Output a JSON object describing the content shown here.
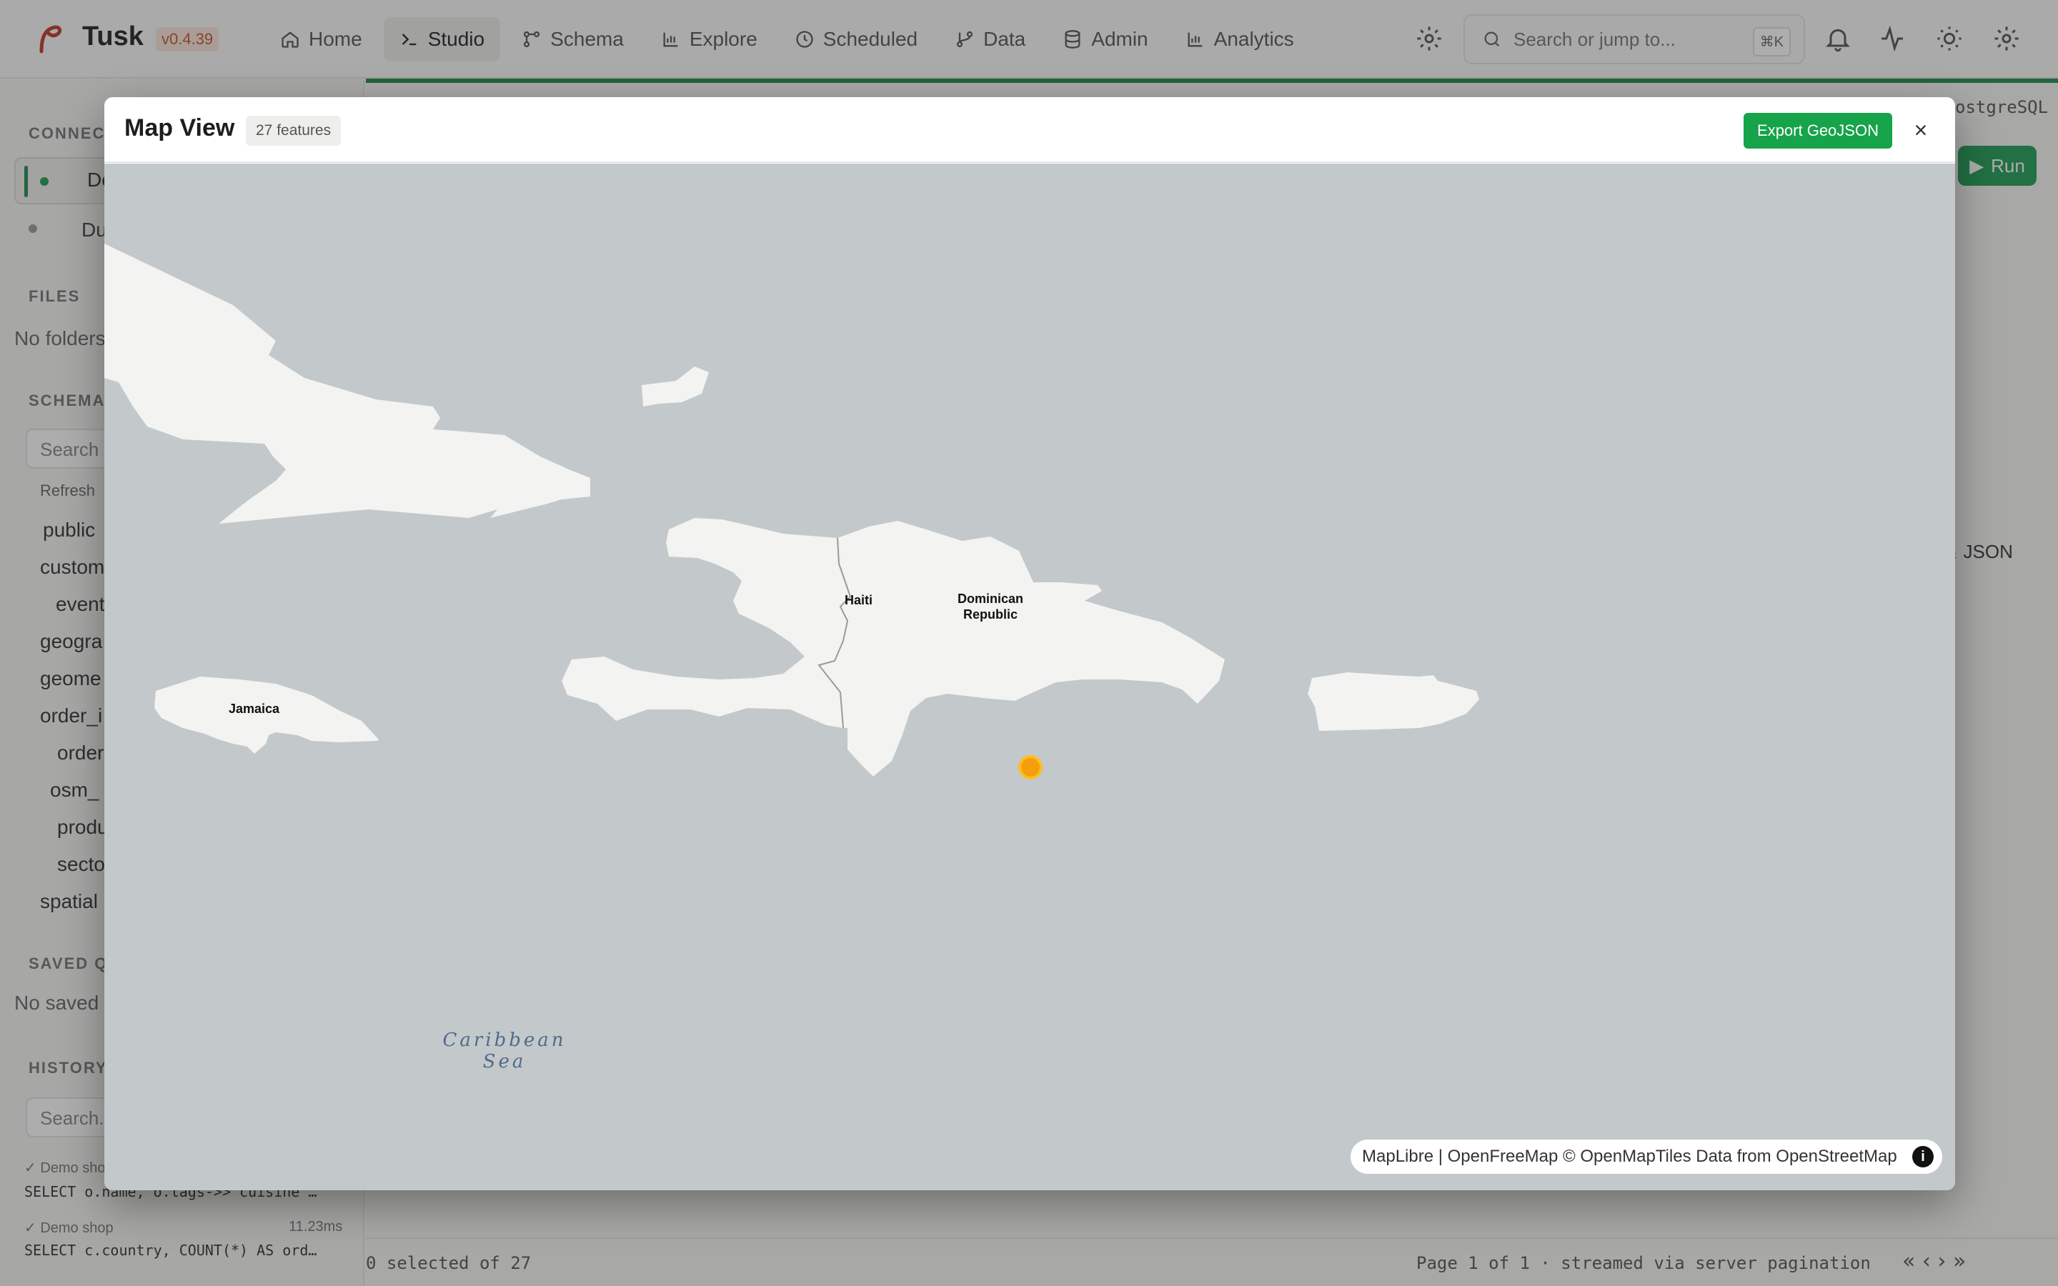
{
  "app": {
    "name": "Tusk",
    "version": "v0.4.39"
  },
  "nav": {
    "items": [
      {
        "label": "Home",
        "icon": "home-icon"
      },
      {
        "label": "Studio",
        "icon": "terminal-icon"
      },
      {
        "label": "Schema",
        "icon": "schema-icon"
      },
      {
        "label": "Explore",
        "icon": "chart-icon"
      },
      {
        "label": "Scheduled",
        "icon": "clock-icon"
      },
      {
        "label": "Data",
        "icon": "branch-icon"
      },
      {
        "label": "Admin",
        "icon": "database-icon"
      },
      {
        "label": "Analytics",
        "icon": "chart-icon"
      }
    ],
    "active": "Studio"
  },
  "search": {
    "placeholder": "Search or jump to...",
    "shortcut": "⌘K"
  },
  "sidebar": {
    "connections_title": "CONNECT",
    "connections": [
      {
        "label": "De"
      },
      {
        "label": "Du"
      }
    ],
    "files_title": "FILES",
    "files_empty": "No folders",
    "schema_title": "SCHEMA",
    "schema_search_placeholder": "Search t",
    "refresh_label": "Refresh",
    "schema_name": "public",
    "tables": [
      "custom",
      "event",
      "geogra",
      "geome",
      "order_i",
      "order",
      "osm_",
      "produ",
      "secto",
      "spatial"
    ],
    "saved_title": "SAVED QU",
    "saved_empty": "No saved",
    "history_title": "HISTORY",
    "history_search_placeholder": "Search...",
    "history": [
      {
        "conn": "✓ Demo sho",
        "time": "",
        "sql": "SELECT o.name, o.tags->>'cuisine'…"
      },
      {
        "conn": "✓ Demo shop",
        "time": "11.23ms",
        "sql": "SELECT c.country, COUNT(*) AS ord…"
      }
    ]
  },
  "main": {
    "dialect_label": "ostgreSQL",
    "run_label": "Run",
    "json_label": "JSON",
    "status_selected": "0 selected of 27",
    "status_page": "Page 1 of 1  ·  streamed via server pagination"
  },
  "modal": {
    "title": "Map View",
    "feature_count": "27 features",
    "export_label": "Export GeoJSON",
    "close_label": "×"
  },
  "map": {
    "labels": {
      "haiti": "Haiti",
      "dominican_republic": "Dominican Republic",
      "jamaica": "Jamaica",
      "sea": "Caribbean Sea"
    },
    "attribution": "MapLibre | OpenFreeMap © OpenMapTiles Data from OpenStreetMap",
    "info": "i",
    "colors": {
      "water": "#c3c8ca",
      "land": "#f3f3f1",
      "border": "#9a9a9a",
      "marker": "#f59e0b"
    }
  }
}
